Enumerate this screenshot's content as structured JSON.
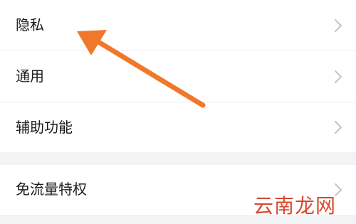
{
  "settings": {
    "items": [
      {
        "label": "隐私"
      },
      {
        "label": "通用"
      },
      {
        "label": "辅助功能"
      },
      {
        "label": "免流量特权"
      }
    ]
  },
  "watermark": {
    "text": "云南龙网"
  },
  "colors": {
    "arrow": "#f0782b",
    "section_gap": "#f2f3f5",
    "chevron": "#c4c4c4",
    "watermark": "#d6492f"
  },
  "icons": {
    "chevron": "chevron-right-icon",
    "arrow": "pointer-arrow-icon"
  }
}
